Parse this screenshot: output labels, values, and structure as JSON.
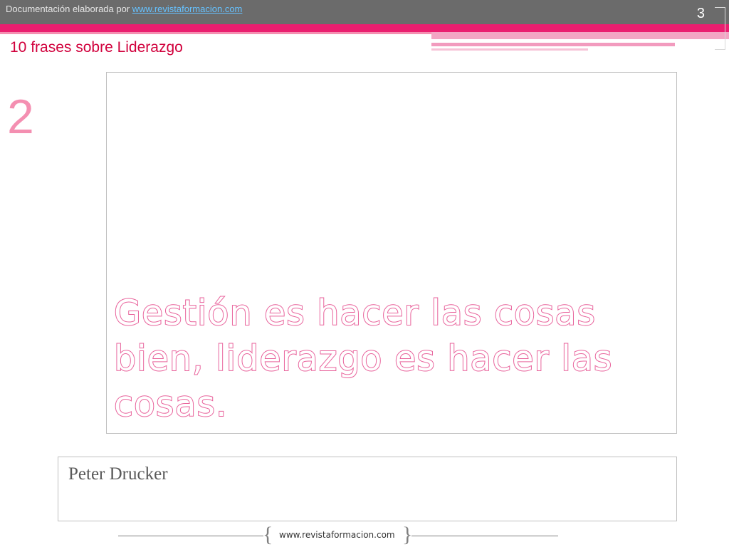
{
  "header": {
    "prefix": "Documentación elaborada por ",
    "link": "www.revistaformacion.com",
    "slide_number": "3"
  },
  "subtitle": "10 frases sobre Liderazgo",
  "quote_number": "2",
  "quote": "Gestión es hacer las cosas bien, liderazgo es hacer las cosas.",
  "author": "Peter Drucker",
  "footer": {
    "brace_left": "{",
    "url": "www.revistaformacion.com",
    "brace_right": "}"
  },
  "colors": {
    "accent_pink": "#ea1e6f",
    "light_pink": "#f48fb1",
    "header_gray": "#6b6b6b",
    "subtitle_red": "#d1003c"
  }
}
